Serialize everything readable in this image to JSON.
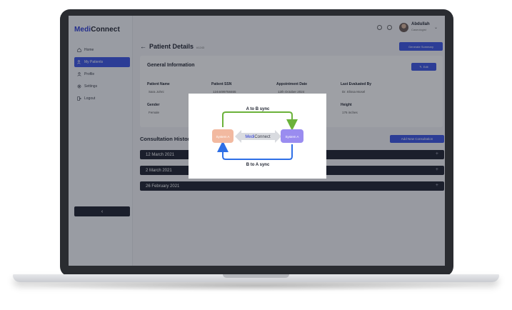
{
  "app": {
    "brand_prefix": "Medi",
    "brand_suffix": "Connect"
  },
  "sidebar": {
    "items": [
      {
        "label": "Home",
        "icon": "home-icon"
      },
      {
        "label": "My Patients",
        "icon": "users-icon",
        "active": true
      },
      {
        "label": "Profile",
        "icon": "user-icon"
      },
      {
        "label": "Settings",
        "icon": "gear-icon"
      },
      {
        "label": "Logout",
        "icon": "logout-icon"
      }
    ],
    "collapse_label": "‹"
  },
  "user": {
    "name": "Abdullah",
    "role": "Caseologist"
  },
  "page": {
    "title": "Patient Details",
    "id": "#1243",
    "generate_label": "Generate Summary"
  },
  "general": {
    "title": "General Information",
    "edit_label": "Edit",
    "fields": [
      {
        "label": "Patient Name",
        "value": "Sara Johni"
      },
      {
        "label": "Patient SSN",
        "value": "1244499758465"
      },
      {
        "label": "Appointment Date",
        "value": "12th October 2024"
      },
      {
        "label": "Last Evaluated By",
        "value": "Dr. Elissa Mosel"
      },
      {
        "label": "Gender",
        "value": "Female"
      },
      {
        "label": "Height",
        "value": "176 inches"
      }
    ]
  },
  "history": {
    "title": "Consultation History",
    "add_label": "Add New Consultation",
    "rows": [
      "12 March 2021",
      "2 March 2021",
      "26 February 2021"
    ]
  },
  "diagram": {
    "top_label": "A to B sync",
    "bottom_label": "B to A sync",
    "left_node": "System A",
    "right_node": "System A",
    "center_prefix": "Medi",
    "center_suffix": "Connect"
  },
  "colors": {
    "accent": "#3b55e6",
    "green": "#6bb23a",
    "blue": "#2f6fe6",
    "left_node": "#f2b9a0",
    "right_node": "#9a8cf0"
  }
}
